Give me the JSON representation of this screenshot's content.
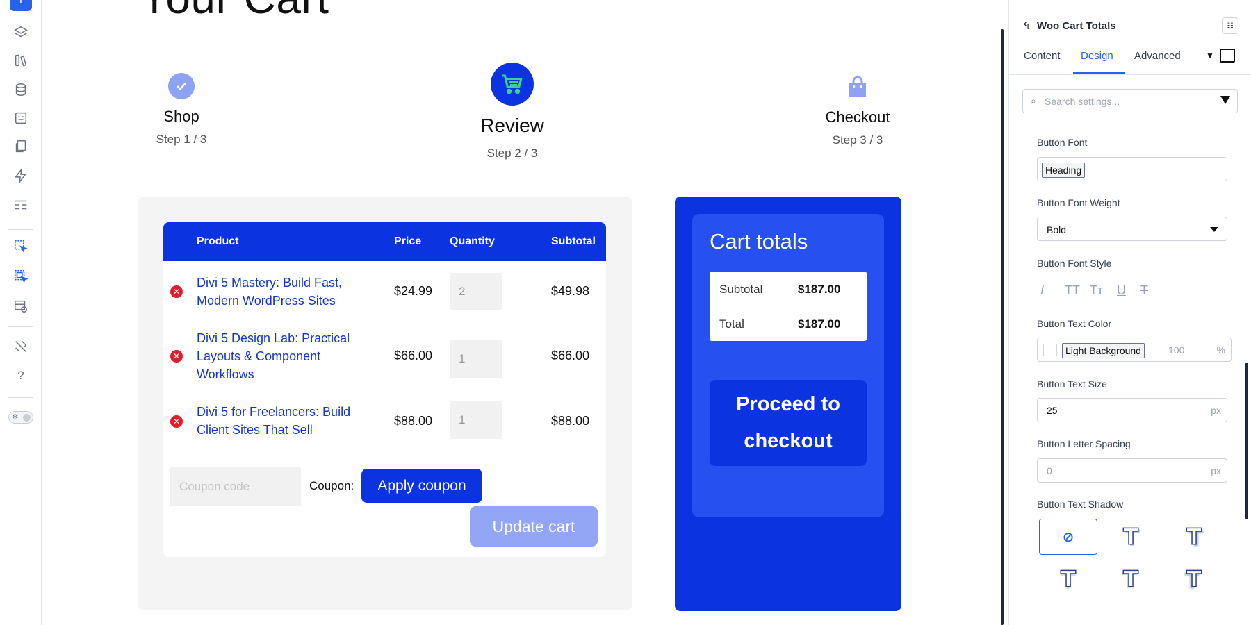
{
  "page": {
    "title": "Your Cart",
    "steps": [
      {
        "title": "Shop",
        "sub": "Step 1 / 3"
      },
      {
        "title": "Review",
        "sub": "Step 2 / 3"
      },
      {
        "title": "Checkout",
        "sub": "Step 3 / 3"
      }
    ]
  },
  "cart": {
    "headers": {
      "product": "Product",
      "price": "Price",
      "quantity": "Quantity",
      "subtotal": "Subtotal"
    },
    "items": [
      {
        "name": "Divi 5 Mastery: Build Fast, Modern WordPress Sites",
        "price": "$24.99",
        "qty": "2",
        "subtotal": "$49.98"
      },
      {
        "name": "Divi 5 Design Lab: Practical Layouts & Component Workflows",
        "price": "$66.00",
        "qty": "1",
        "subtotal": "$66.00"
      },
      {
        "name": "Divi 5 for Freelancers: Build Client Sites That Sell",
        "price": "$88.00",
        "qty": "1",
        "subtotal": "$88.00"
      }
    ],
    "coupon_placeholder": "Coupon code",
    "coupon_label": "Coupon:",
    "apply_label": "Apply coupon",
    "update_label": "Update cart"
  },
  "totals": {
    "title": "Cart totals",
    "subtotal_label": "Subtotal",
    "subtotal_value": "$187.00",
    "total_label": "Total",
    "total_value": "$187.00",
    "checkout_line1": "Proceed to",
    "checkout_line2": "checkout"
  },
  "settings": {
    "title": "Woo Cart Totals",
    "tabs": [
      "Content",
      "Design",
      "Advanced"
    ],
    "active_tab": "Design",
    "search_placeholder": "Search settings...",
    "fields": {
      "font_label": "Button Font",
      "font_value": "Heading",
      "weight_label": "Button Font Weight",
      "weight_value": "Bold",
      "style_label": "Button Font Style",
      "style_icons": [
        "I",
        "TT",
        "Tт",
        "U",
        "T"
      ],
      "color_label": "Button Text Color",
      "color_value": "Light Background",
      "color_opacity": "100",
      "color_unit": "%",
      "size_label": "Button Text Size",
      "size_value": "25",
      "size_unit": "px",
      "spacing_label": "Button Letter Spacing",
      "spacing_placeholder": "0",
      "spacing_unit": "px",
      "shadow_label": "Button Text Shadow",
      "shadow_glyph": "T",
      "shadow_none_glyph": "⊘"
    }
  },
  "toolbar": {
    "add_glyph": "+",
    "help_glyph": "?"
  },
  "colors": {
    "brand_blue": "#0b33e0",
    "accent_blue": "#2563eb",
    "remove_red": "#e11d2a"
  }
}
